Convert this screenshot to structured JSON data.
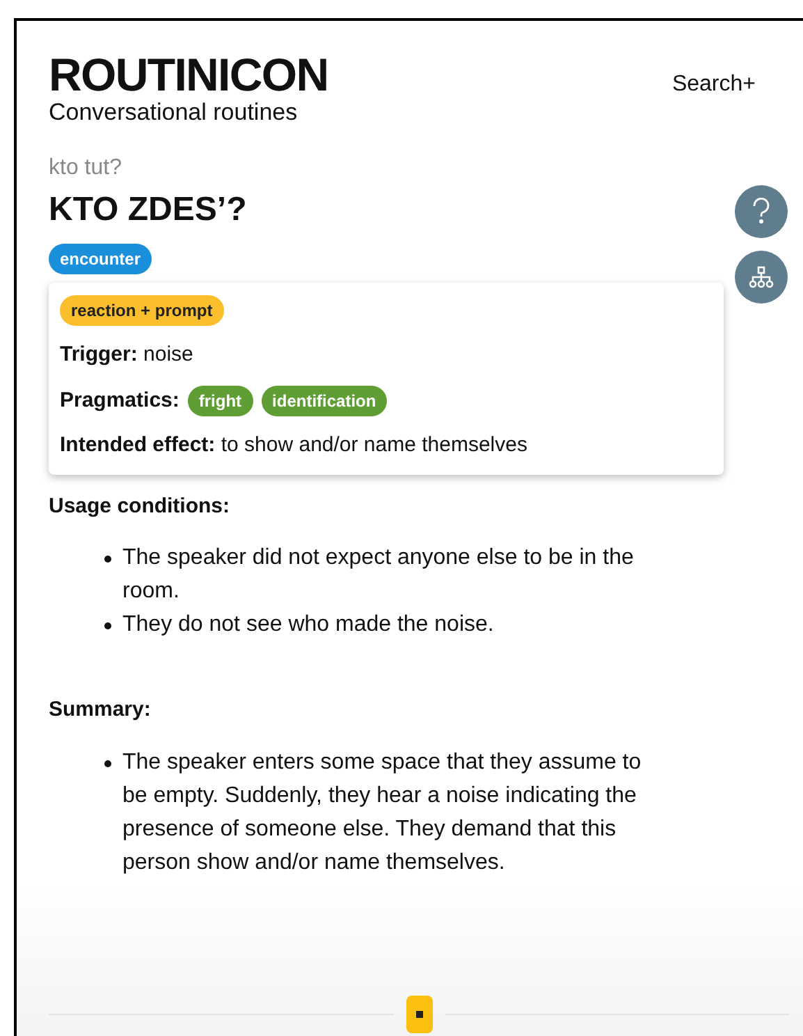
{
  "header": {
    "title": "ROUTINICON",
    "subtitle": "Conversational routines",
    "search_link": "Search+"
  },
  "entry": {
    "transliteration": "kto tut?",
    "headword": "KTO ZDES’?",
    "category_tags": [
      {
        "label": "encounter",
        "color": "#1a8fdb"
      }
    ],
    "card": {
      "type_tags": [
        {
          "label": "reaction + prompt",
          "color": "#fbbf2d"
        }
      ],
      "trigger": {
        "label": "Trigger:",
        "value": "noise"
      },
      "pragmatics": {
        "label": "Pragmatics:",
        "tags": [
          {
            "label": "fright",
            "color": "#5f9e35"
          },
          {
            "label": "identification",
            "color": "#5f9e35"
          }
        ]
      },
      "intended_effect": {
        "label": "Intended effect:",
        "value": "to show and/or name themselves"
      }
    },
    "sections": [
      {
        "heading": "Usage conditions:",
        "items": [
          "The speaker did not expect anyone else to be in the room.",
          "They do not see who made the noise."
        ]
      },
      {
        "heading": "Summary:",
        "items": [
          "The speaker enters some space that they assume to be empty. Suddenly, they hear a noise indicating the presence of someone else. They demand that this person show and/or name themselves."
        ]
      }
    ]
  }
}
